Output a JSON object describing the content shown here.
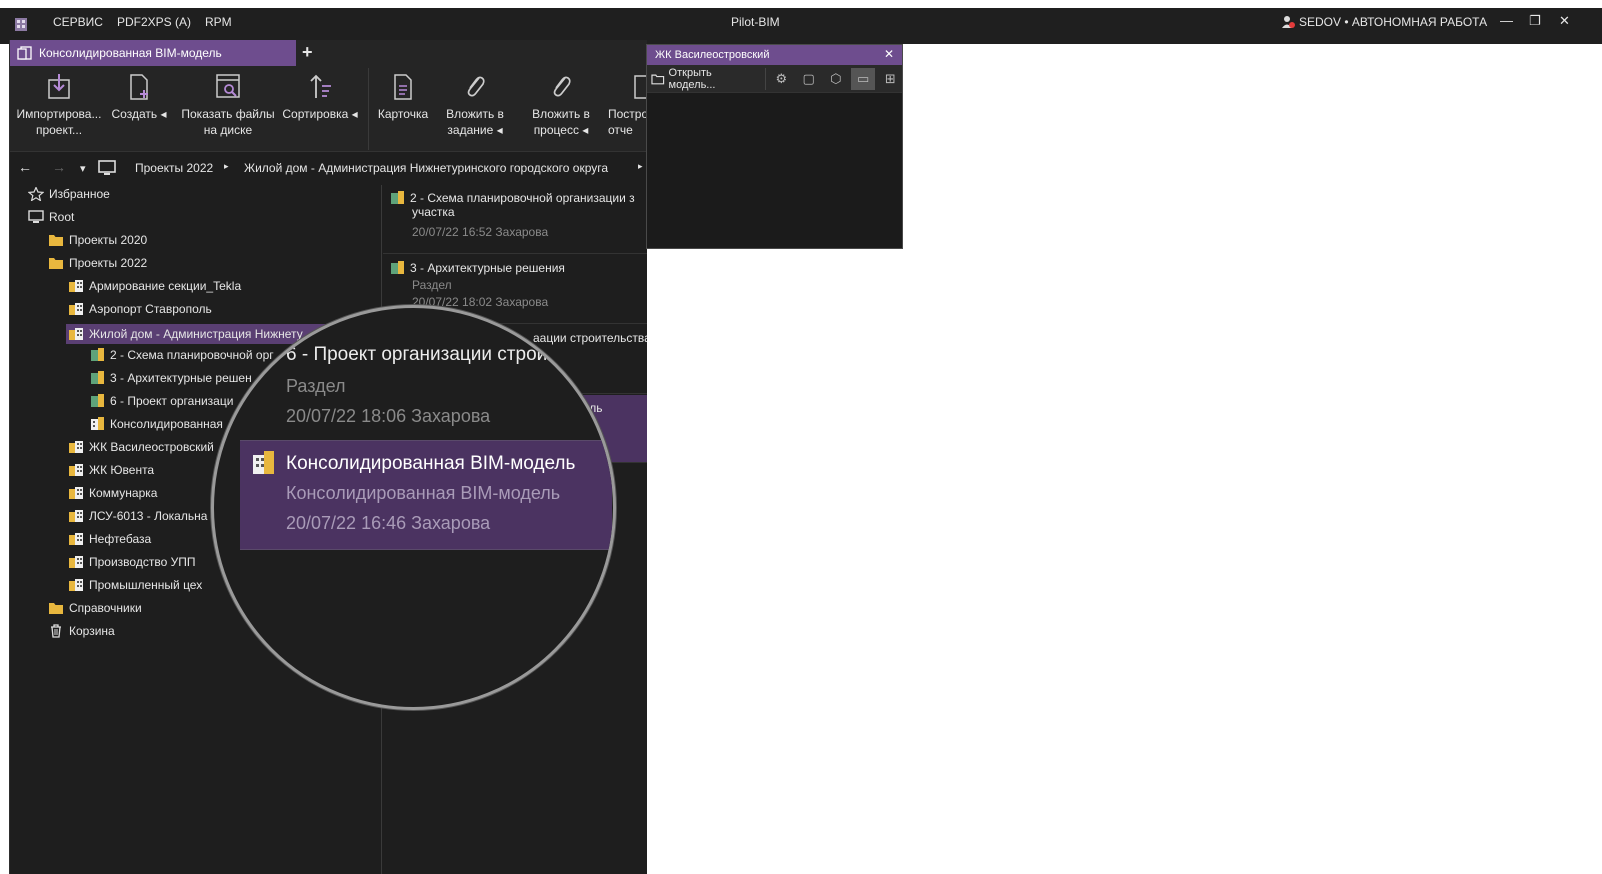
{
  "titlebar": {
    "menus": [
      "СЕРВИС",
      "PDF2XPS (A)",
      "RPM"
    ],
    "title": "Pilot-BIM",
    "user": "SEDOV • АВТОНОМНАЯ РАБОТА",
    "buttons": {
      "minimize": "—",
      "restore": "❐",
      "close": "✕"
    }
  },
  "tabs": {
    "active": "Консолидированная BIM-модель",
    "add": "+"
  },
  "ribbon": {
    "import": "Импортирова... проект...",
    "create": "Создать ◂",
    "show_files": "Показать файлы на диске",
    "sort": "Сортировка ◂",
    "card": "Карточка",
    "attach_task": "Вложить в задание ◂",
    "attach_process": "Вложить в процесс ◂",
    "build_report": "Постро отче"
  },
  "navbar": {
    "back": "←",
    "forward": "→",
    "dropdown": "▾",
    "breadcrumbs": [
      "Проекты 2022",
      "Жилой дом - Администрация Нижнетуринского городского округа"
    ]
  },
  "tree": {
    "items": [
      {
        "label": "Избранное",
        "icon": "star-icon"
      },
      {
        "label": "Root",
        "icon": "computer-icon"
      },
      {
        "label": "Проекты 2020",
        "icon": "folder-icon"
      },
      {
        "label": "Проекты 2022",
        "icon": "folder-icon"
      },
      {
        "label": "Армирование секции_Tekla",
        "icon": "project-icon"
      },
      {
        "label": "Аэропорт Ставрополь",
        "icon": "project-icon"
      },
      {
        "label": "Жилой дом - Администрация Нижнету",
        "icon": "project-icon"
      },
      {
        "label": "2 - Схема планировочной орг",
        "icon": "section-icon"
      },
      {
        "label": "3 - Архитектурные решен",
        "icon": "section-icon"
      },
      {
        "label": "6 - Проект организаци",
        "icon": "section-icon"
      },
      {
        "label": "Консолидированная",
        "icon": "bim-icon"
      },
      {
        "label": "ЖК Василеостровский",
        "icon": "project-icon"
      },
      {
        "label": "ЖК Ювента",
        "icon": "project-icon"
      },
      {
        "label": "Коммунарка",
        "icon": "project-icon"
      },
      {
        "label": "ЛСУ-6013 - Локальна",
        "icon": "project-icon"
      },
      {
        "label": "Нефтебаза",
        "icon": "project-icon"
      },
      {
        "label": "Производство УПП",
        "icon": "project-icon"
      },
      {
        "label": "Промышленный цех",
        "icon": "project-icon"
      },
      {
        "label": "Справочники",
        "icon": "folder-icon"
      },
      {
        "label": "Корзина",
        "icon": "trash-icon"
      }
    ]
  },
  "list": {
    "items": [
      {
        "title": "2 - Схема планировочной организации з",
        "title2": "участка",
        "meta": "20/07/22 16:52 Захарова"
      },
      {
        "title": "3 - Архитектурные решения",
        "sub": "Раздел",
        "meta": "20/07/22 18:02 Захарова"
      },
      {
        "title": "аации строительства"
      },
      {
        "title": "ель",
        "sub": "ль"
      }
    ]
  },
  "panel": {
    "title": "ЖК Василеостровский",
    "close": "✕",
    "open_model": "Открыть модель..."
  },
  "magnifier": {
    "prev_title": "6 - Проект организации строи",
    "prev_sub": "Раздел",
    "prev_meta": "20/07/22 18:06 Захарова",
    "sel_title": "Консолидированная BIM-модель",
    "sel_sub": "Консолидированная BIM-модель",
    "sel_meta": "20/07/22 16:46 Захарова"
  },
  "colors": {
    "accent": "#6e4d8e",
    "selection": "#5a3f73",
    "background": "#1e1e1e"
  }
}
